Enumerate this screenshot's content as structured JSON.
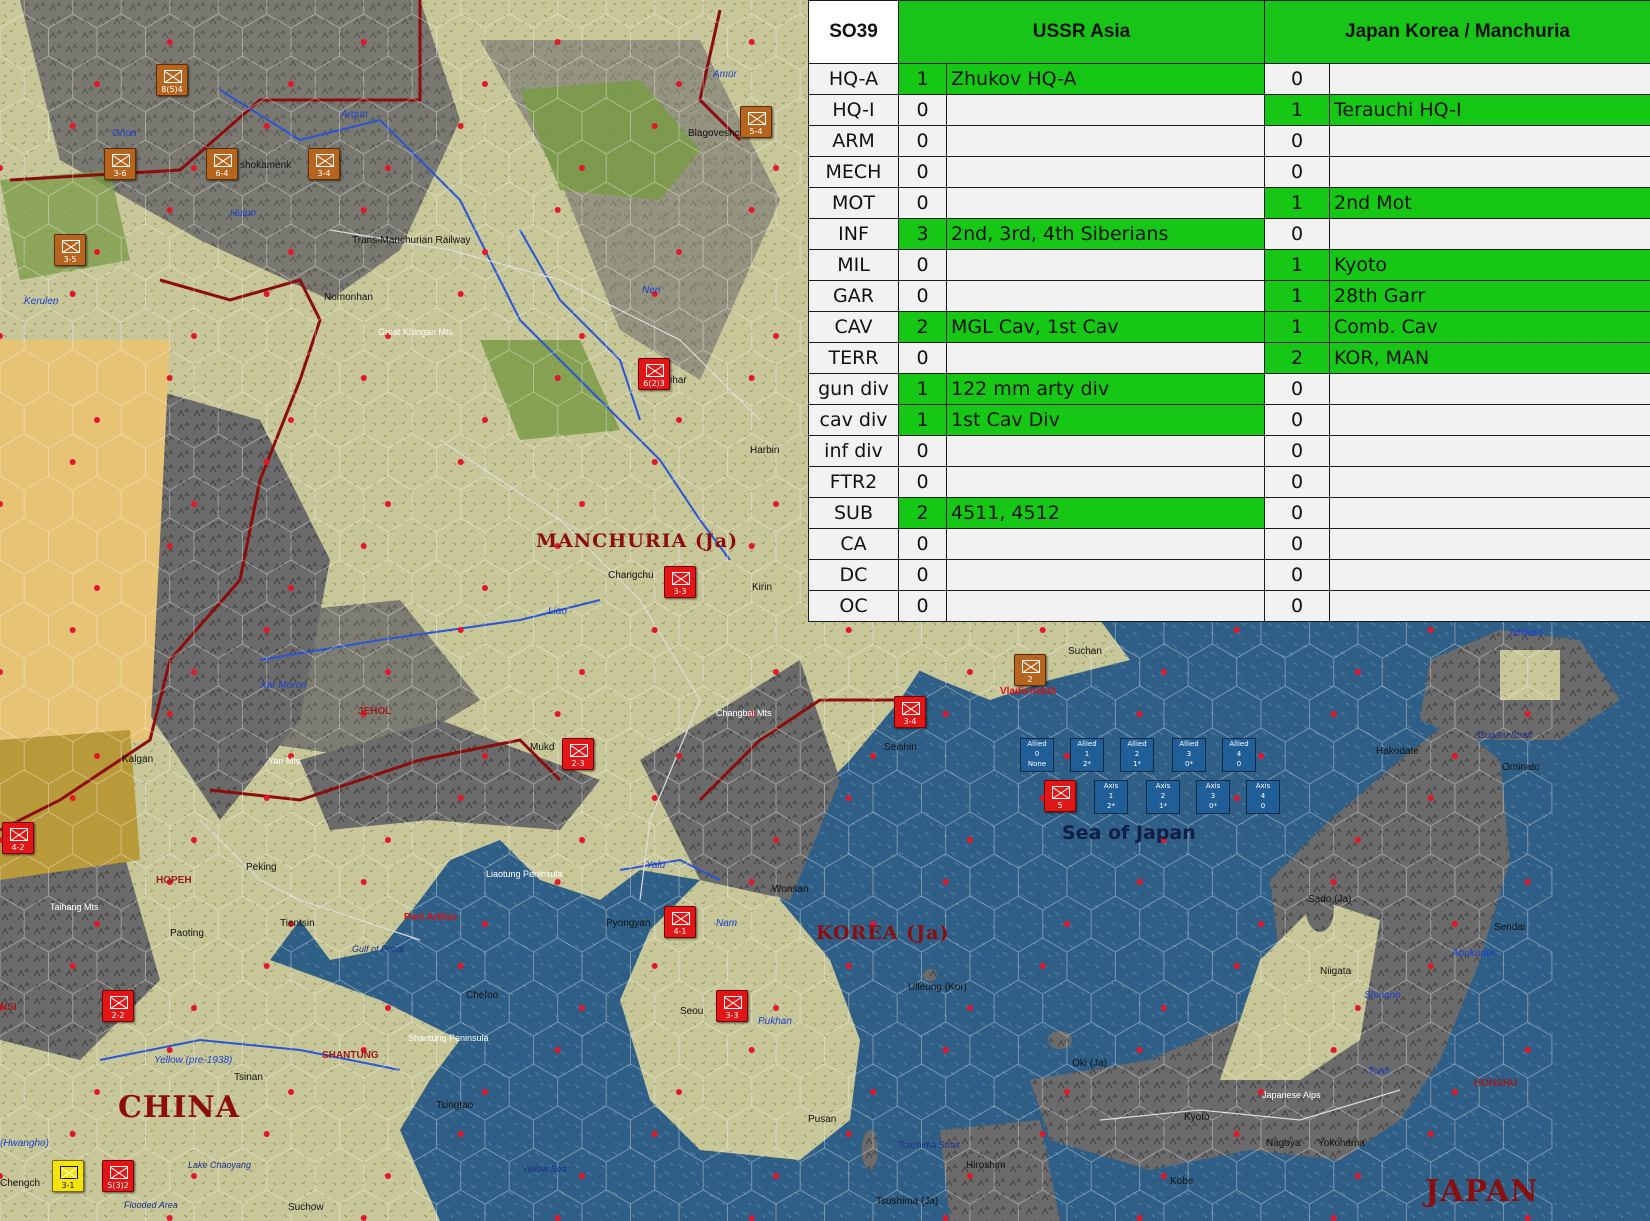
{
  "map": {
    "colors": {
      "sea": "#2f5f86",
      "plains": "#c8c79a",
      "mountain": "#6c6c6c",
      "forest": "#7a9b45",
      "desert": "#e7c375",
      "border": "#8b0d0d"
    },
    "labels": {
      "manchuria": "MANCHURIA (Ja)",
      "korea": "KOREA (Ja)",
      "china": "CHINA",
      "japan": "JAPAN",
      "sea_of_japan": "Sea of Japan",
      "jehol": "JEHOL",
      "hopeh": "HOPEH",
      "shantung": "SHANTUNG",
      "honshu": "HONSHU",
      "argun": "Argun",
      "onon": "Onon",
      "amur": "Amur",
      "hulun": "Hulun",
      "kerulen": "Kerulen",
      "nen": "Nen",
      "liao": "Liao",
      "xar_moron": "Xar Moron",
      "yalu": "Yalu",
      "nam": "Nam",
      "pukhan": "Pukhan",
      "yellow": "Yellow (pre-1938)",
      "shinano": "Shinano",
      "abukuma": "Abukuma",
      "tone": "Tone",
      "ishikari": "Ishikari",
      "blagoveshch": "Blagoveshch",
      "trans_manchurian": "Trans-Manchurian Railway",
      "nomonhan": "Nomonhan",
      "great_khingan": "Great Khingan Mts",
      "harbin": "Harbin",
      "tsitsihar": "ihar",
      "changchun": "Changchu",
      "kirin": "Kirin",
      "mukden": "Mukd",
      "kalgan": "Kalgan",
      "yan_mts": "Yan Mts",
      "changbai": "Changbai Mts",
      "taihang": "Taihang Mts",
      "peking": "Peking",
      "tientsin": "Tientsin",
      "paoting": "Paoting",
      "port_arthur": "Port Arthur",
      "liaotung": "Liaotung Peninsula",
      "gulf_pohai": "Gulf of Pohai",
      "chefoo": "Chefoo",
      "shantung_pen": "Shantung Peninsula",
      "tsinan": "Tsinan",
      "tsingtao": "Tsingtao",
      "pyongyang": "Pyongyan",
      "wonsan": "Wonsan",
      "seoul": "Seou",
      "pusan": "Pusan",
      "seishin": "Seishin",
      "vladivostok": "Vladivostok",
      "suchan": "Suchan",
      "hakodate": "Hakodate",
      "ominato": "Ominato",
      "tsugaru": "Tsugaru Strait",
      "sendai": "Sendai",
      "niigata": "Niigata",
      "sado": "Sado (Ja)",
      "ulleung": "Ulleung (Kor)",
      "oki": "Oki (Ja)",
      "tsushima_strait": "Tsushima Strait",
      "tsushima": "Tsushima (Ja)",
      "hiroshima": "Hiroshim",
      "kyoto": "Kyoto",
      "kobe": "Kobe",
      "nagoya": "Nagoya",
      "yokohama": "Yokohama",
      "japanese_alps": "Japanese Alps",
      "suchow": "Suchow",
      "lake_chaoyang": "Lake Chaoyang",
      "flooded": "Flooded Area",
      "yellow_sea": "Yellow Sea",
      "shokamen": "shokamenk",
      "chengchow": "Chengch",
      "hwangho": "(Hwangho)",
      "nsi": "NSI"
    },
    "counters": [
      {
        "id": "c1",
        "color": "red",
        "value": "6(2)3"
      },
      {
        "id": "c2",
        "color": "red",
        "value": "3-3"
      },
      {
        "id": "c3",
        "color": "red",
        "value": "2-3"
      },
      {
        "id": "c4",
        "color": "red",
        "value": "4-1"
      },
      {
        "id": "c5",
        "color": "red",
        "value": "3-3"
      },
      {
        "id": "c6",
        "color": "red",
        "value": "3-4"
      },
      {
        "id": "c7",
        "color": "red",
        "value": "2-2"
      },
      {
        "id": "c8",
        "color": "red",
        "value": "5(3)2"
      },
      {
        "id": "c9",
        "color": "red",
        "value": "4-2"
      },
      {
        "id": "c10",
        "color": "brown",
        "value": "8(5)4"
      },
      {
        "id": "c11",
        "color": "brown",
        "value": "5-4"
      },
      {
        "id": "c12",
        "color": "brown",
        "value": "3-6"
      },
      {
        "id": "c13",
        "color": "brown",
        "value": "6-4"
      },
      {
        "id": "c14",
        "color": "brown",
        "value": "3-4"
      },
      {
        "id": "c15",
        "color": "brown",
        "value": "3-5"
      },
      {
        "id": "c16",
        "color": "brown",
        "value": "2"
      },
      {
        "id": "c17",
        "color": "yellow",
        "value": "3-1"
      },
      {
        "id": "c18",
        "color": "red",
        "value": "5"
      }
    ],
    "allied_boxes": [
      {
        "title": "Allied",
        "num": "0",
        "sub": "None"
      },
      {
        "title": "Allied",
        "num": "1",
        "sub": "2*"
      },
      {
        "title": "Allied",
        "num": "2",
        "sub": "1*"
      },
      {
        "title": "Allied",
        "num": "3",
        "sub": "0*"
      },
      {
        "title": "Allied",
        "num": "4",
        "sub": "0"
      }
    ],
    "axis_boxes": [
      {
        "title": "Axis",
        "num": "1",
        "sub": "2*"
      },
      {
        "title": "Axis",
        "num": "2",
        "sub": "1*"
      },
      {
        "title": "Axis",
        "num": "3",
        "sub": "0*"
      },
      {
        "title": "Axis",
        "num": "4",
        "sub": "0"
      }
    ]
  },
  "oob_table": {
    "title": "SO39",
    "side_a": "USSR Asia",
    "side_b": "Japan Korea / Manchuria",
    "rows": [
      {
        "cat": "HQ-A",
        "a_n": "1",
        "a_u": "Zhukov HQ-A",
        "b_n": "0",
        "b_u": ""
      },
      {
        "cat": "HQ-I",
        "a_n": "0",
        "a_u": "",
        "b_n": "1",
        "b_u": "Terauchi HQ-I"
      },
      {
        "cat": "ARM",
        "a_n": "0",
        "a_u": "",
        "b_n": "0",
        "b_u": ""
      },
      {
        "cat": "MECH",
        "a_n": "0",
        "a_u": "",
        "b_n": "0",
        "b_u": ""
      },
      {
        "cat": "MOT",
        "a_n": "0",
        "a_u": "",
        "b_n": "1",
        "b_u": "2nd Mot"
      },
      {
        "cat": "INF",
        "a_n": "3",
        "a_u": "2nd, 3rd, 4th Siberians",
        "b_n": "0",
        "b_u": ""
      },
      {
        "cat": "MIL",
        "a_n": "0",
        "a_u": "",
        "b_n": "1",
        "b_u": "Kyoto"
      },
      {
        "cat": "GAR",
        "a_n": "0",
        "a_u": "",
        "b_n": "1",
        "b_u": "28th Garr"
      },
      {
        "cat": "CAV",
        "a_n": "2",
        "a_u": "MGL Cav, 1st Cav",
        "b_n": "1",
        "b_u": "Comb. Cav"
      },
      {
        "cat": "TERR",
        "a_n": "0",
        "a_u": "",
        "b_n": "2",
        "b_u": "KOR, MAN"
      },
      {
        "cat": "gun div",
        "a_n": "1",
        "a_u": "122 mm arty div",
        "b_n": "0",
        "b_u": ""
      },
      {
        "cat": "cav div",
        "a_n": "1",
        "a_u": "1st Cav Div",
        "b_n": "0",
        "b_u": ""
      },
      {
        "cat": "inf div",
        "a_n": "0",
        "a_u": "",
        "b_n": "0",
        "b_u": ""
      },
      {
        "cat": "FTR2",
        "a_n": "0",
        "a_u": "",
        "b_n": "0",
        "b_u": ""
      },
      {
        "cat": "SUB",
        "a_n": "2",
        "a_u": "4511, 4512",
        "b_n": "0",
        "b_u": ""
      },
      {
        "cat": "CA",
        "a_n": "0",
        "a_u": "",
        "b_n": "0",
        "b_u": ""
      },
      {
        "cat": "DC",
        "a_n": "0",
        "a_u": "",
        "b_n": "0",
        "b_u": ""
      },
      {
        "cat": "OC",
        "a_n": "0",
        "a_u": "",
        "b_n": "0",
        "b_u": ""
      }
    ]
  }
}
